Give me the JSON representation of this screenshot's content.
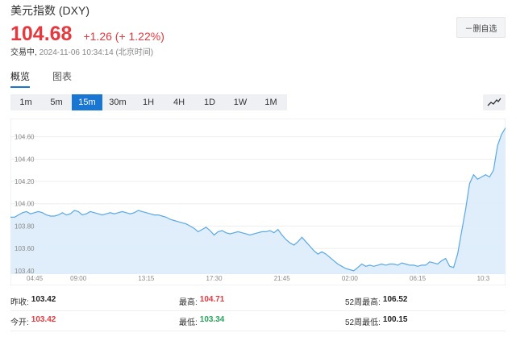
{
  "quote": {
    "title": "美元指数 (DXY)",
    "price": "104.68",
    "change": "+1.26 (+ 1.22%)",
    "status": "交易中,",
    "timestamp": "2024-11-06 10:34:14 (北京时间)"
  },
  "actions": {
    "unwatch_label": "－删自选"
  },
  "tabs": [
    {
      "label": "概览",
      "active": true
    },
    {
      "label": "图表",
      "active": false
    }
  ],
  "periods": [
    "1m",
    "5m",
    "15m",
    "30m",
    "1H",
    "4H",
    "1D",
    "1W",
    "1M"
  ],
  "active_period": "15m",
  "colors": {
    "up": "#e5393f",
    "down": "#26a65b",
    "accent": "#1976d2",
    "line": "#5aa9e6",
    "fill": "#dcecfa"
  },
  "chart_data": {
    "type": "area",
    "ylim": [
      103.37,
      104.72
    ],
    "y_ticks": [
      103.4,
      103.6,
      103.8,
      104.0,
      104.2,
      104.4,
      104.6
    ],
    "x_ticks": [
      "04:45",
      "09:00",
      "13:15",
      "17:30",
      "21:45",
      "02:00",
      "06:15",
      "10:3"
    ],
    "x_tick_index": [
      0,
      17,
      34,
      51,
      68,
      85,
      102,
      120
    ],
    "grid": true,
    "values": [
      103.88,
      103.88,
      103.9,
      103.92,
      103.93,
      103.91,
      103.92,
      103.93,
      103.92,
      103.9,
      103.89,
      103.89,
      103.9,
      103.92,
      103.9,
      103.91,
      103.94,
      103.93,
      103.9,
      103.91,
      103.93,
      103.92,
      103.91,
      103.9,
      103.91,
      103.92,
      103.91,
      103.92,
      103.93,
      103.92,
      103.91,
      103.92,
      103.94,
      103.93,
      103.92,
      103.91,
      103.9,
      103.9,
      103.89,
      103.88,
      103.86,
      103.85,
      103.84,
      103.83,
      103.82,
      103.8,
      103.78,
      103.75,
      103.77,
      103.79,
      103.76,
      103.72,
      103.75,
      103.76,
      103.74,
      103.73,
      103.74,
      103.75,
      103.74,
      103.73,
      103.72,
      103.73,
      103.74,
      103.75,
      103.75,
      103.76,
      103.74,
      103.77,
      103.72,
      103.68,
      103.65,
      103.63,
      103.66,
      103.7,
      103.66,
      103.62,
      103.58,
      103.55,
      103.57,
      103.55,
      103.52,
      103.49,
      103.46,
      103.44,
      103.42,
      103.41,
      103.4,
      103.43,
      103.46,
      103.44,
      103.45,
      103.44,
      103.45,
      103.46,
      103.45,
      103.46,
      103.46,
      103.45,
      103.47,
      103.46,
      103.45,
      103.45,
      103.44,
      103.45,
      103.45,
      103.48,
      103.47,
      103.46,
      103.49,
      103.51,
      103.44,
      103.43,
      103.55,
      103.75,
      103.95,
      104.18,
      104.26,
      104.22,
      104.24,
      104.26,
      104.24,
      104.3,
      104.52,
      104.62,
      104.68
    ],
    "stats": {
      "prev_close": {
        "label": "昨收:",
        "value": "103.42"
      },
      "open": {
        "label": "今开:",
        "value": "103.42"
      },
      "high": {
        "label": "最高:",
        "value": "104.71"
      },
      "low": {
        "label": "最低:",
        "value": "103.34"
      },
      "week52_high": {
        "label": "52周最高:",
        "value": "106.52"
      },
      "week52_low": {
        "label": "52周最低:",
        "value": "100.15"
      }
    }
  }
}
